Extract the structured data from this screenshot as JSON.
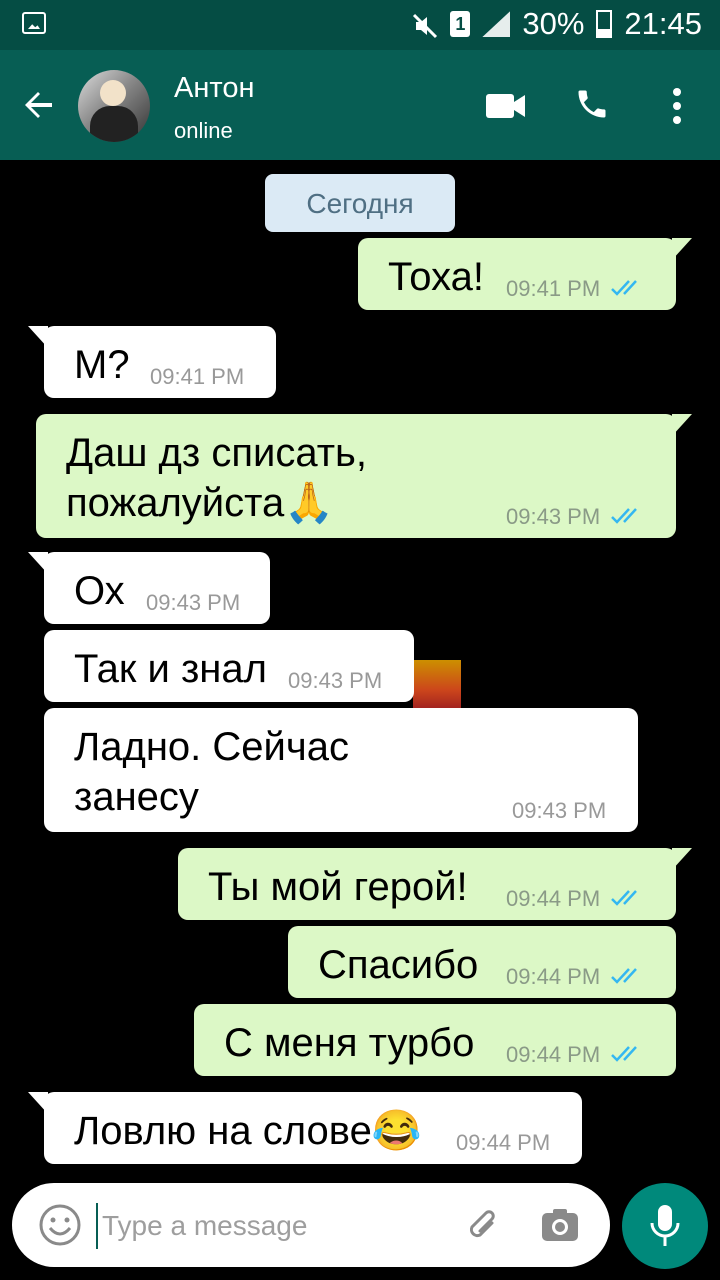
{
  "status_bar": {
    "sim": "1",
    "battery": "30%",
    "time": "21:45"
  },
  "header": {
    "name": "Антон",
    "status": "online"
  },
  "date_label": "Сегодня",
  "messages": [
    {
      "dir": "out",
      "text": "Тоха!",
      "time": "09:41 PM"
    },
    {
      "dir": "in",
      "text": "М?",
      "time": "09:41 PM"
    },
    {
      "dir": "out",
      "text": "Даш дз списать,\nпожалуйста🙏",
      "time": "09:43 PM"
    },
    {
      "dir": "in",
      "text": "Ох",
      "time": "09:43 PM"
    },
    {
      "dir": "in",
      "text": "Так и знал",
      "time": "09:43 PM"
    },
    {
      "dir": "in",
      "text": "Ладно. Сейчас\nзанесу",
      "time": "09:43 PM"
    },
    {
      "dir": "out",
      "text": "Ты мой герой!",
      "time": "09:44 PM"
    },
    {
      "dir": "out",
      "text": "Спасибо",
      "time": "09:44 PM"
    },
    {
      "dir": "out",
      "text": "С меня турбо",
      "time": "09:44 PM"
    },
    {
      "dir": "in",
      "text": "Ловлю на слове😂",
      "time": "09:44 PM"
    }
  ],
  "composer": {
    "placeholder": "Type a message"
  },
  "colors": {
    "header": "#075e54",
    "status_bar": "#054d44",
    "outgoing": "#dcf8c6",
    "incoming": "#ffffff",
    "read_ticks": "#34b7f1",
    "mic_button": "#00897b"
  }
}
